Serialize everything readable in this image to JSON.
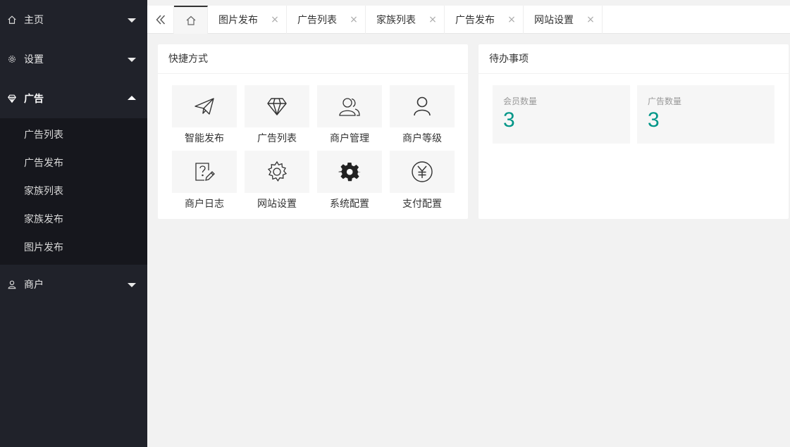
{
  "sidebar": {
    "home": {
      "label": "主页",
      "icon": "home-icon"
    },
    "settings": {
      "label": "设置",
      "icon": "gear-icon"
    },
    "ads": {
      "label": "广告",
      "icon": "diamond-icon",
      "items": [
        {
          "label": "广告列表"
        },
        {
          "label": "广告发布"
        },
        {
          "label": "家族列表"
        },
        {
          "label": "家族发布"
        },
        {
          "label": "图片发布"
        }
      ]
    },
    "merchant": {
      "label": "商户",
      "icon": "user-icon"
    }
  },
  "tabs": [
    {
      "label": "图片发布",
      "close": "×"
    },
    {
      "label": "广告列表",
      "close": "×"
    },
    {
      "label": "家族列表",
      "close": "×"
    },
    {
      "label": "广告发布",
      "close": "×"
    },
    {
      "label": "网站设置",
      "close": "×"
    }
  ],
  "shortcuts": {
    "title": "快捷方式",
    "items": [
      {
        "label": "智能发布",
        "icon": "paper-plane-icon"
      },
      {
        "label": "广告列表",
        "icon": "diamond-icon"
      },
      {
        "label": "商户管理",
        "icon": "users-icon"
      },
      {
        "label": "商户等级",
        "icon": "user-icon"
      },
      {
        "label": "商户日志",
        "icon": "help-doc-icon"
      },
      {
        "label": "网站设置",
        "icon": "gear-icon"
      },
      {
        "label": "系统配置",
        "icon": "gear-filled-icon"
      },
      {
        "label": "支付配置",
        "icon": "yen-icon"
      }
    ]
  },
  "todo": {
    "title": "待办事项",
    "stats": [
      {
        "label": "会员数量",
        "value": "3"
      },
      {
        "label": "广告数量",
        "value": "3"
      }
    ]
  },
  "colors": {
    "sidebar_bg": "#20222a",
    "submenu_bg": "#16171d",
    "accent": "#009688",
    "page_bg": "#f2f2f2"
  }
}
